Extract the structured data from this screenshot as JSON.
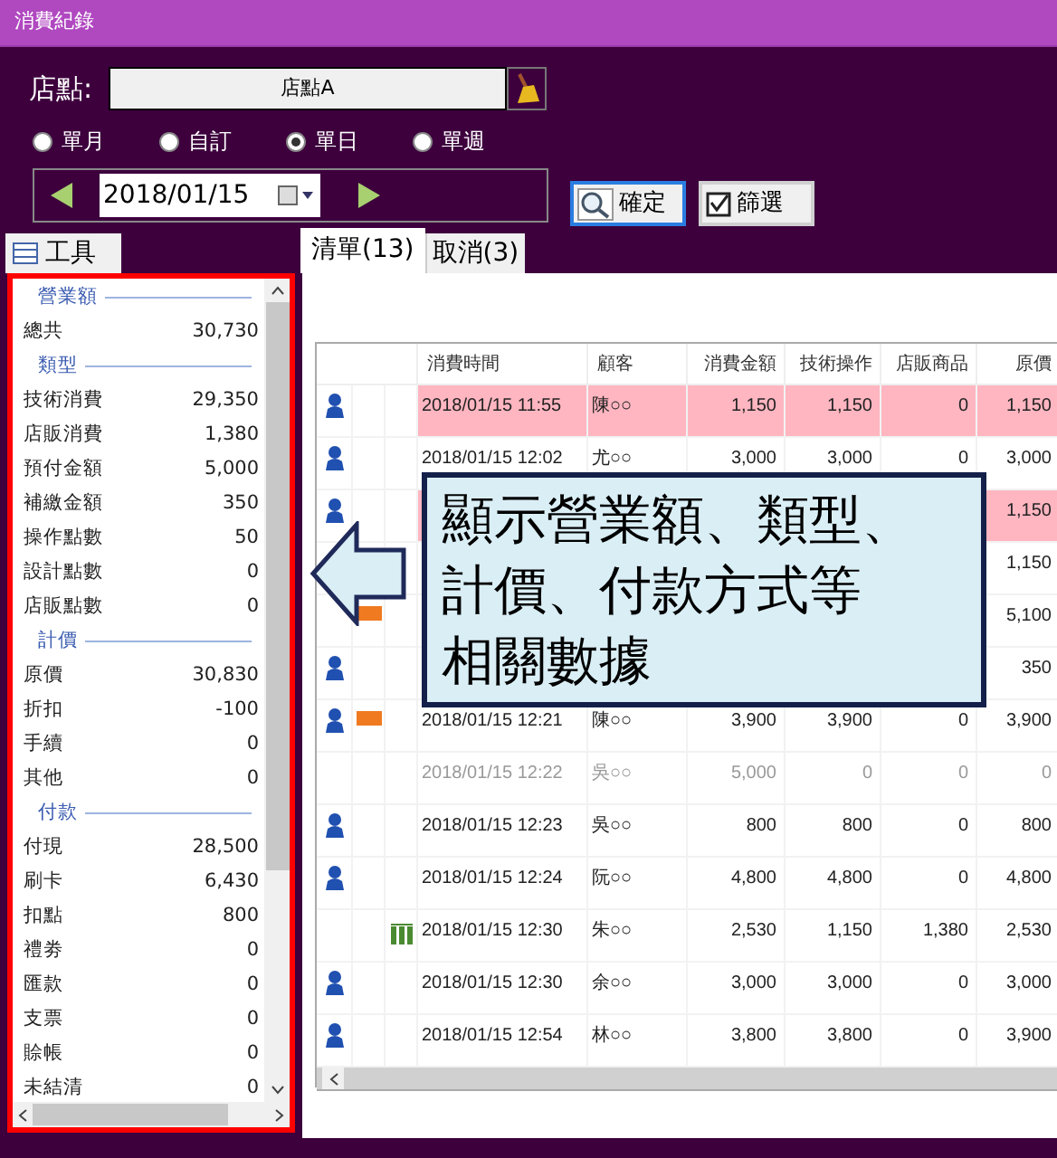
{
  "window": {
    "title": "消費紀錄"
  },
  "store": {
    "label": "店點:",
    "value": "店點A"
  },
  "period_options": [
    {
      "label": "單月",
      "selected": false
    },
    {
      "label": "自訂",
      "selected": false
    },
    {
      "label": "單日",
      "selected": true
    },
    {
      "label": "單週",
      "selected": false
    }
  ],
  "date": {
    "value": "2018/01/15"
  },
  "buttons": [
    {
      "kind": "search",
      "label": "確定",
      "focused": true
    },
    {
      "kind": "filter",
      "label": "篩選",
      "focused": false
    }
  ],
  "tools_tab": {
    "label": "工具"
  },
  "tabs": [
    {
      "label": "清單(13)",
      "selected": true
    },
    {
      "label": "取消(3)",
      "selected": false
    }
  ],
  "summary": [
    {
      "kind": "header",
      "label": "營業額"
    },
    {
      "kind": "row",
      "label": "總共",
      "value": "30,730"
    },
    {
      "kind": "header",
      "label": "類型"
    },
    {
      "kind": "row",
      "label": "技術消費",
      "value": "29,350"
    },
    {
      "kind": "row",
      "label": "店販消費",
      "value": "1,380"
    },
    {
      "kind": "row",
      "label": "預付金額",
      "value": "5,000"
    },
    {
      "kind": "row",
      "label": "補繳金額",
      "value": "350"
    },
    {
      "kind": "row",
      "label": "操作點數",
      "value": "50"
    },
    {
      "kind": "row",
      "label": "設計點數",
      "value": "0"
    },
    {
      "kind": "row",
      "label": "店販點數",
      "value": "0"
    },
    {
      "kind": "header",
      "label": "計價"
    },
    {
      "kind": "row",
      "label": "原價",
      "value": "30,830"
    },
    {
      "kind": "row",
      "label": "折扣",
      "value": "-100"
    },
    {
      "kind": "row",
      "label": "手續",
      "value": "0"
    },
    {
      "kind": "row",
      "label": "其他",
      "value": "0"
    },
    {
      "kind": "header",
      "label": "付款"
    },
    {
      "kind": "row",
      "label": "付現",
      "value": "28,500"
    },
    {
      "kind": "row",
      "label": "刷卡",
      "value": "6,430"
    },
    {
      "kind": "row",
      "label": "扣點",
      "value": "800"
    },
    {
      "kind": "row",
      "label": "禮劵",
      "value": "0"
    },
    {
      "kind": "row",
      "label": "匯款",
      "value": "0"
    },
    {
      "kind": "row",
      "label": "支票",
      "value": "0"
    },
    {
      "kind": "row",
      "label": "賒帳",
      "value": "0"
    },
    {
      "kind": "row",
      "label": "未結清",
      "value": "0"
    }
  ],
  "table": {
    "columns": [
      "消費時間",
      "顧客",
      "消費金額",
      "技術操作",
      "店販商品",
      "原價"
    ],
    "rows": [
      {
        "member": true,
        "new": false,
        "product": false,
        "highlight": true,
        "cancelled": false,
        "cells": [
          "2018/01/15 11:55",
          "陳○○",
          "1,150",
          "1,150",
          "0",
          "1,150"
        ]
      },
      {
        "member": true,
        "new": false,
        "product": false,
        "highlight": false,
        "cancelled": false,
        "cells": [
          "2018/01/15 12:02",
          "尤○○",
          "3,000",
          "3,000",
          "0",
          "3,000"
        ]
      },
      {
        "member": true,
        "new": false,
        "product": false,
        "highlight": true,
        "cancelled": false,
        "cells": [
          null,
          null,
          null,
          null,
          null,
          "1,150"
        ]
      },
      {
        "highlight": false,
        "cancelled": false,
        "cells": [
          null,
          null,
          null,
          null,
          null,
          "1,150"
        ]
      },
      {
        "member": false,
        "new": true,
        "product": false,
        "highlight": false,
        "cancelled": false,
        "cells": [
          null,
          null,
          null,
          null,
          null,
          "5,100"
        ]
      },
      {
        "member": true,
        "new": false,
        "product": false,
        "highlight": false,
        "cancelled": false,
        "cells": [
          null,
          null,
          null,
          null,
          null,
          "350"
        ]
      },
      {
        "member": true,
        "new": true,
        "product": false,
        "highlight": false,
        "cancelled": false,
        "cells": [
          "2018/01/15 12:21",
          "陳○○",
          "3,900",
          "3,900",
          "0",
          "3,900"
        ]
      },
      {
        "member": false,
        "new": false,
        "product": false,
        "highlight": false,
        "cancelled": true,
        "cells": [
          "2018/01/15 12:22",
          "吳○○",
          "5,000",
          "0",
          "0",
          "0"
        ]
      },
      {
        "member": true,
        "new": false,
        "product": false,
        "highlight": false,
        "cancelled": false,
        "cells": [
          "2018/01/15 12:23",
          "吳○○",
          "800",
          "800",
          "0",
          "800"
        ]
      },
      {
        "member": true,
        "new": false,
        "product": false,
        "highlight": false,
        "cancelled": false,
        "cells": [
          "2018/01/15 12:24",
          "阮○○",
          "4,800",
          "4,800",
          "0",
          "4,800"
        ]
      },
      {
        "member": false,
        "new": false,
        "product": true,
        "highlight": false,
        "cancelled": false,
        "cells": [
          "2018/01/15 12:30",
          "朱○○",
          "2,530",
          "1,150",
          "1,380",
          "2,530"
        ]
      },
      {
        "member": true,
        "new": false,
        "product": false,
        "highlight": false,
        "cancelled": false,
        "cells": [
          "2018/01/15 12:30",
          "余○○",
          "3,000",
          "3,000",
          "0",
          "3,000"
        ]
      },
      {
        "member": true,
        "new": false,
        "product": false,
        "highlight": false,
        "cancelled": false,
        "cells": [
          "2018/01/15 12:54",
          "林○○",
          "3,800",
          "3,800",
          "0",
          "3,900"
        ]
      }
    ]
  },
  "callout": {
    "lines": [
      "顯示營業額、類型、",
      "計價、付款方式等",
      "相關數據"
    ]
  }
}
